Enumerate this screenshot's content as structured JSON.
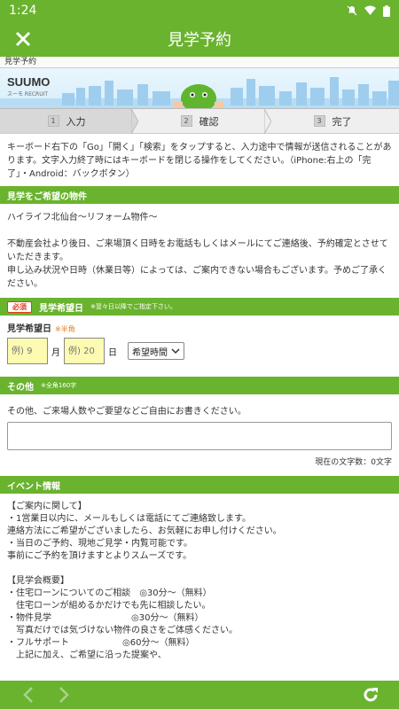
{
  "status_bar": {
    "time": "1:24"
  },
  "appbar": {
    "title": "見学予約"
  },
  "page_label": "見学予約",
  "banner": {
    "logo": "SUUMO",
    "logo_sub": "スーモ  RECRUIT"
  },
  "steps": [
    {
      "num": "1",
      "label": "入力"
    },
    {
      "num": "2",
      "label": "確認"
    },
    {
      "num": "3",
      "label": "完了"
    }
  ],
  "notice": "キーボード右下の「Go」「開く」「検索」をタップすると、入力途中で情報が送信されることがあります。文字入力終了時にはキーボードを閉じる操作をしてください。（iPhone:右上の「完了」・Android：バックボタン）",
  "property_section": {
    "title": "見学をご希望の物件",
    "name": "ハイライフ北仙台〜リフォーム物件〜",
    "desc1": "不動産会社より後日、ご来場頂く日時をお電話もしくはメールにてご連絡後、予約確定とさせていただきます。",
    "desc2": "申し込み状況や日時（休業日等）によっては、ご案内できない場合もございます。予めご了承ください。"
  },
  "date_section": {
    "required": "必須",
    "title": "見学希望日",
    "note": "※翌々日以降でご指定下さい。",
    "label": "見学希望日",
    "half": "※半角",
    "month_placeholder": "例) 9",
    "month_unit": "月",
    "day_placeholder": "例) 20",
    "day_unit": "日",
    "time_select": "希望時間"
  },
  "other_section": {
    "title": "その他",
    "note": "※全角160字",
    "prompt": "その他、ご来場人数やご要望などご自由にお書きください。",
    "count": "現在の文字数：0文字"
  },
  "event_section": {
    "title": "イベント情報",
    "text": "【ご案内に関して】\n・1営業日以内に、メールもしくは電話にてご連絡致します。\n連絡方法にご希望がございましたら、お気軽にお申し付けください。\n・当日のご予約、現地ご見学・内覧可能です。\n事前にご予約を頂けますとよりスムーズです。\n\n【見学会概要】\n・住宅ローンについてのご相談　◎30分〜（無料）\n　住宅ローンが組めるかだけでも先に相談したい。\n・物件見学　　　　　　　　　◎30分〜（無料）\n　写真だけでは気づけない物件の良さをご体感ください。\n・フルサポート　　　　　　◎60分〜（無料）\n　上記に加え、ご希望に沿った提案や、"
  },
  "colors": {
    "primary_green": "#6ab32e",
    "input_yellow": "#fdfbb1",
    "required_red": "#e03c1f"
  }
}
